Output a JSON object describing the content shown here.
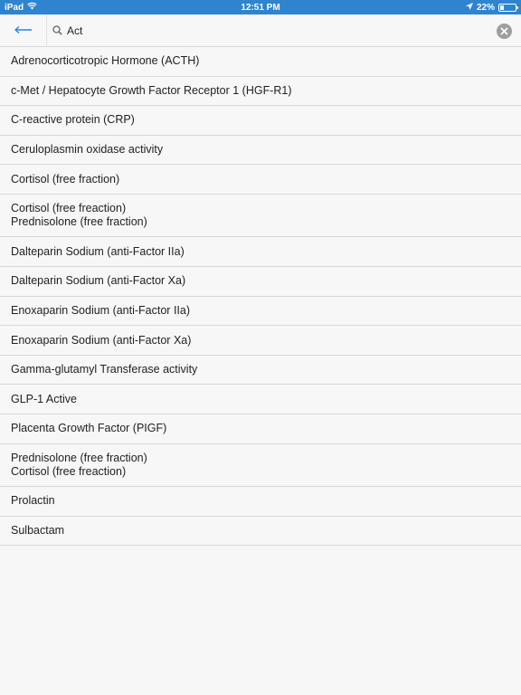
{
  "status_bar": {
    "device": "iPad",
    "time": "12:51 PM",
    "battery_percent_text": "22%",
    "battery_level": 0.22
  },
  "search": {
    "query": "Act",
    "placeholder": "Search"
  },
  "icons": {
    "back": "arrow-left-icon",
    "search": "magnifier-icon",
    "clear": "clear-circle-x-icon",
    "wifi": "wifi-icon",
    "location": "location-arrow-icon",
    "battery": "battery-icon"
  },
  "colors": {
    "status_bar_bg": "#2f84d0",
    "accent": "#2f84d0",
    "clear_button": "#9e9e9e"
  },
  "results": [
    {
      "lines": [
        "Adrenocorticotropic Hormone (ACTH)"
      ]
    },
    {
      "lines": [
        "c-Met / Hepatocyte Growth Factor Receptor 1 (HGF-R1)"
      ]
    },
    {
      "lines": [
        "C-reactive protein (CRP)"
      ]
    },
    {
      "lines": [
        "Ceruloplasmin oxidase activity"
      ]
    },
    {
      "lines": [
        "Cortisol (free fraction)"
      ]
    },
    {
      "lines": [
        "Cortisol (free freaction)",
        "Prednisolone (free fraction)"
      ]
    },
    {
      "lines": [
        "Dalteparin Sodium (anti-Factor IIa)"
      ]
    },
    {
      "lines": [
        "Dalteparin Sodium (anti-Factor Xa)"
      ]
    },
    {
      "lines": [
        "Enoxaparin Sodium (anti-Factor IIa)"
      ]
    },
    {
      "lines": [
        "Enoxaparin Sodium (anti-Factor Xa)"
      ]
    },
    {
      "lines": [
        "Gamma-glutamyl Transferase activity"
      ]
    },
    {
      "lines": [
        "GLP-1 Active"
      ]
    },
    {
      "lines": [
        "Placenta Growth Factor (PIGF)"
      ]
    },
    {
      "lines": [
        "Prednisolone (free fraction)",
        "Cortisol (free freaction)"
      ]
    },
    {
      "lines": [
        "Prolactin"
      ]
    },
    {
      "lines": [
        "Sulbactam"
      ]
    }
  ]
}
